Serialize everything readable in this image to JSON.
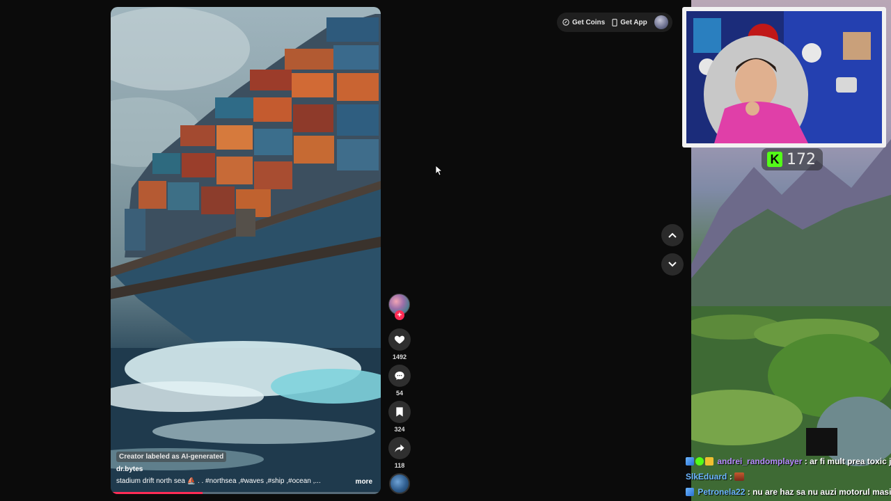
{
  "video": {
    "ai_label": "Creator labeled as AI-generated",
    "author": "dr.bytes",
    "caption": "stadium drift north sea ⛵ . . #northsea ,#waves ,#ship ,#ocean ,...",
    "more_label": "more",
    "progress": 0.34
  },
  "actions": {
    "likes": "1492",
    "comments": "54",
    "saves": "324",
    "shares": "118",
    "follow_symbol": "+"
  },
  "header": {
    "get_coins": "Get Coins",
    "get_app": "Get App"
  },
  "overlay": {
    "kick_logo": "K",
    "viewer_count": "172",
    "accent": "#53fc18"
  },
  "chat": [
    {
      "user": "andrei_randomplayer",
      "text": ": ar fi mult prea toxic jo",
      "color": "purple"
    },
    {
      "user": "SlkEduard",
      "text": ":",
      "color": "blue"
    },
    {
      "user": "Petronela22",
      "text": ": nu are haz sa nu auzi motorul masin",
      "color": "blue"
    }
  ],
  "icons": [
    "coin-icon",
    "phone-icon",
    "heart-icon",
    "comment-icon",
    "bookmark-icon",
    "share-icon",
    "chevron-up-icon",
    "chevron-down-icon",
    "cursor-icon"
  ]
}
